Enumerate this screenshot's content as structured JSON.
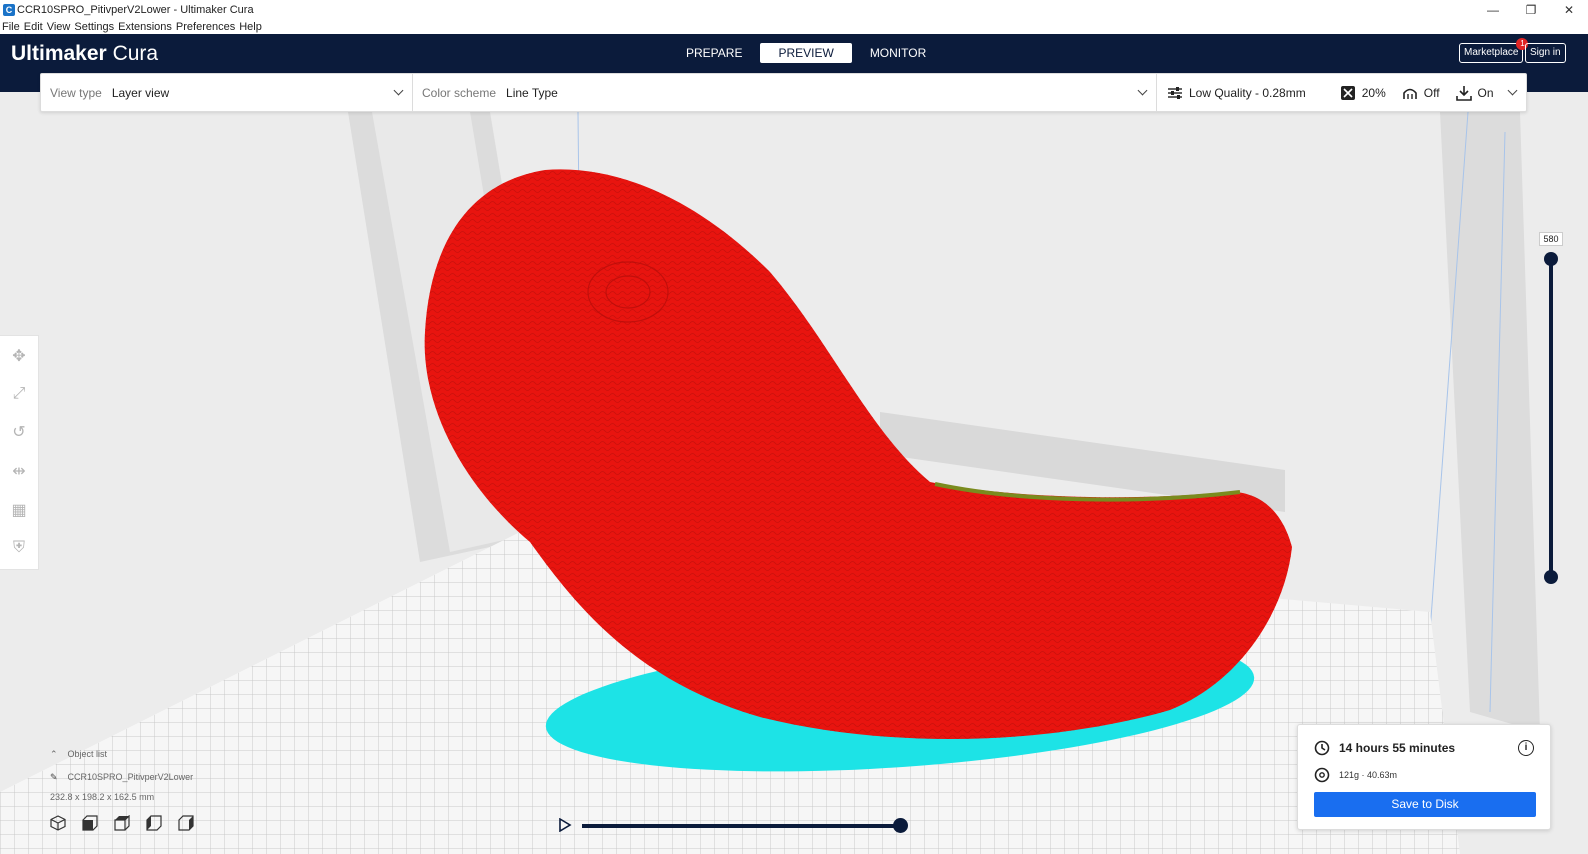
{
  "window": {
    "title": "CCR10SPRO_PitivperV2Lower - Ultimaker Cura",
    "controls": {
      "minimize": "—",
      "maximize": "❐",
      "close": "✕"
    }
  },
  "menu": [
    "File",
    "Edit",
    "View",
    "Settings",
    "Extensions",
    "Preferences",
    "Help"
  ],
  "header": {
    "logo_bold": "Ultimaker",
    "logo_light": "Cura",
    "stages": [
      "PREPARE",
      "PREVIEW",
      "MONITOR"
    ],
    "active_stage": "PREVIEW",
    "marketplace_label": "Marketplace",
    "marketplace_badge": "1",
    "signin_label": "Sign in"
  },
  "toolbar": {
    "view_type_label": "View type",
    "view_type_value": "Layer view",
    "color_scheme_label": "Color scheme",
    "color_scheme_value": "Line Type",
    "profile": "Low Quality - 0.28mm",
    "infill": "20%",
    "support": "Off",
    "adhesion": "On"
  },
  "layer_slider": {
    "max_layer": "580"
  },
  "object_list": {
    "header": "Object list",
    "object_name": "CCR10SPRO_PitivperV2Lower",
    "dimensions": "232.8 x 198.2 x 162.5 mm"
  },
  "print_info": {
    "time": "14 hours 55 minutes",
    "material": "121g · 40.63m",
    "save_label": "Save to Disk"
  },
  "colors": {
    "header_bg": "#0b1b3b",
    "accent": "#196ef0",
    "model_wall": "#e8140f",
    "model_skirt": "#1de3e6"
  }
}
